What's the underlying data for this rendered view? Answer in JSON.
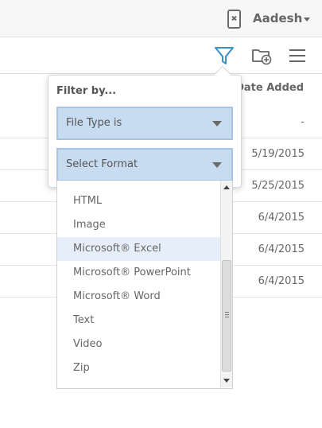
{
  "header": {
    "user_name": "Aadesh",
    "phone_icon": "phone-off-icon",
    "accent_color": "#3a8fc7"
  },
  "toolbar": {
    "icons": [
      "filter-icon",
      "folder-add-icon",
      "menu-icon"
    ]
  },
  "table": {
    "column_header": "Date Added",
    "rows": [
      {
        "date": "-"
      },
      {
        "date": "5/19/2015"
      },
      {
        "date": "5/25/2015"
      },
      {
        "date": "6/4/2015"
      },
      {
        "date": "6/4/2015"
      },
      {
        "date": "6/4/2015"
      }
    ]
  },
  "filter": {
    "title": "Filter by...",
    "field_select": "File Type is",
    "format_select": "Select Format",
    "options": [
      "HTML",
      "Image",
      "Microsoft® Excel",
      "Microsoft® PowerPoint",
      "Microsoft® Word",
      "Text",
      "Video",
      "Zip"
    ],
    "highlighted_option": "Microsoft® Excel",
    "select_bg_color": "#c7dbf1"
  }
}
